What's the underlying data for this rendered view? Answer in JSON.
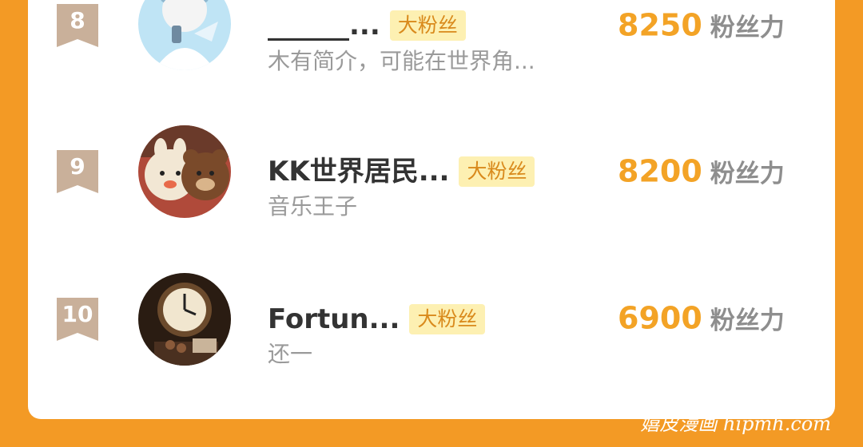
{
  "rows": [
    {
      "rank": "8",
      "name": "______...",
      "badge": "大粉丝",
      "intro": "木有简介，可能在世界角...",
      "score": "8250",
      "unit": "粉丝力"
    },
    {
      "rank": "9",
      "name": "KK世界居民...",
      "badge": "大粉丝",
      "intro": "音乐王子",
      "score": "8200",
      "unit": "粉丝力"
    },
    {
      "rank": "10",
      "name": "Fortun...",
      "badge": "大粉丝",
      "intro": "还一",
      "score": "6900",
      "unit": "粉丝力"
    }
  ],
  "watermark": "嬉皮漫画 hipmh.com",
  "colors": {
    "background": "#f39a25",
    "rank_ribbon": "#c9b09a",
    "score": "#f3a326",
    "badge_bg": "#fdf0b2",
    "badge_text": "#d98a1c"
  },
  "icons": {
    "rank": "ribbon-bookmark-icon"
  }
}
